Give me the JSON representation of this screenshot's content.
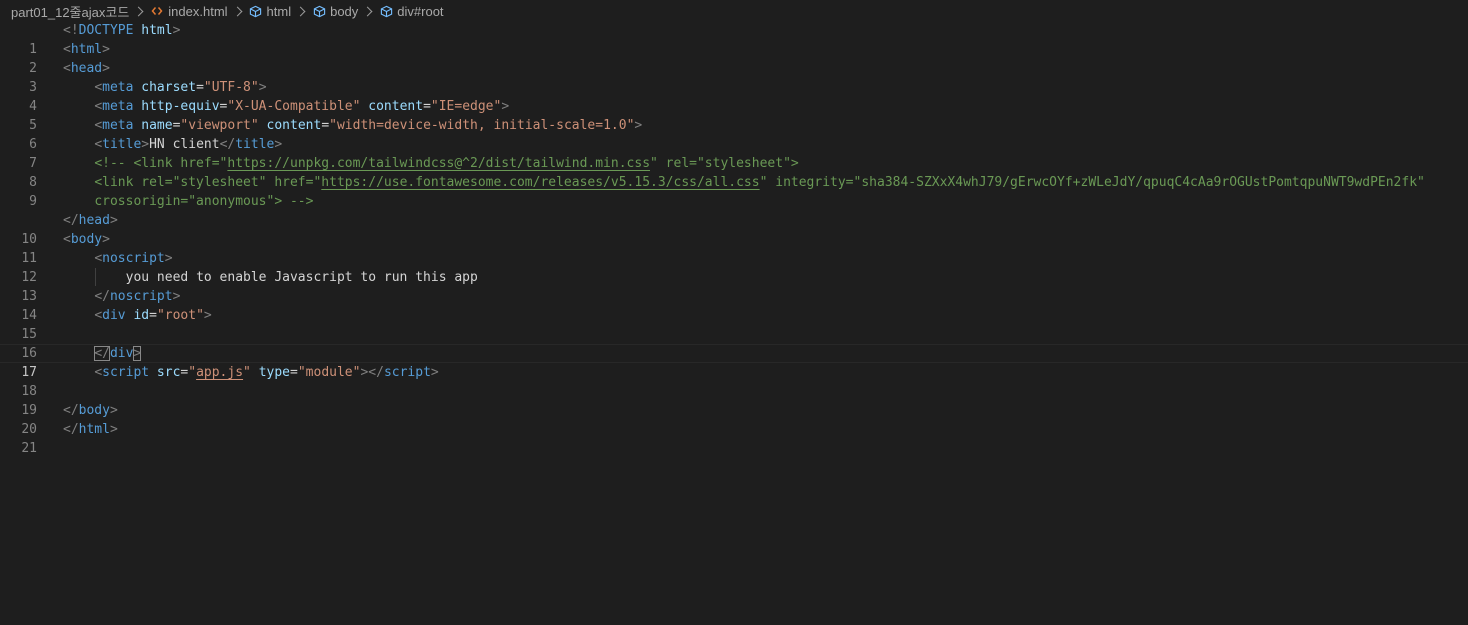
{
  "breadcrumb": {
    "folder": "part01_12줄ajax코드",
    "file": "index.html",
    "symbols": [
      "html",
      "body",
      "div#root"
    ]
  },
  "editor": {
    "current_line": 17,
    "lines": [
      {
        "n": "1"
      },
      {
        "n": "2"
      },
      {
        "n": "3"
      },
      {
        "n": "4"
      },
      {
        "n": "5"
      },
      {
        "n": "6"
      },
      {
        "n": "7"
      },
      {
        "n": "8"
      },
      {
        "n": "9"
      },
      {
        "n": ""
      },
      {
        "n": "10"
      },
      {
        "n": "11"
      },
      {
        "n": "12"
      },
      {
        "n": "13"
      },
      {
        "n": "14"
      },
      {
        "n": "15"
      },
      {
        "n": "16"
      },
      {
        "n": "17"
      },
      {
        "n": "18"
      },
      {
        "n": "19"
      },
      {
        "n": "20"
      },
      {
        "n": "21"
      }
    ],
    "code": {
      "l1": {
        "open": "<!",
        "doctype": "DOCTYPE",
        "sp": " ",
        "html": "html",
        "close": ">"
      },
      "l2": {
        "open": "<",
        "tag": "html",
        "close": ">"
      },
      "l3": {
        "open": "<",
        "tag": "head",
        "close": ">"
      },
      "l4": {
        "indent": "    ",
        "open": "<",
        "tag": "meta",
        "a1": " charset",
        "eq1": "=",
        "v1": "\"UTF-8\"",
        "close": ">"
      },
      "l5": {
        "indent": "    ",
        "open": "<",
        "tag": "meta",
        "a1": " http-equiv",
        "eq1": "=",
        "v1": "\"X-UA-Compatible\"",
        "a2": " content",
        "eq2": "=",
        "v2": "\"IE=edge\"",
        "close": ">"
      },
      "l6": {
        "indent": "    ",
        "open": "<",
        "tag": "meta",
        "a1": " name",
        "eq1": "=",
        "v1": "\"viewport\"",
        "a2": " content",
        "eq2": "=",
        "v2": "\"width=device-width, initial-scale=1.0\"",
        "close": ">"
      },
      "l7": {
        "indent": "    ",
        "open": "<",
        "tag": "title",
        "close": ">",
        "text": "HN client",
        "open2": "</",
        "tag2": "title",
        "close2": ">"
      },
      "l8": {
        "indent": "    ",
        "c1": "<!-- <link href=\"",
        "url": "https://unpkg.com/tailwindcss@^2/dist/tailwind.min.css",
        "c2": "\" rel=\"stylesheet\">"
      },
      "l9": {
        "indent": "    ",
        "c1": "<link rel=\"stylesheet\" href=\"",
        "url": "https://use.fontawesome.com/releases/v5.15.3/css/all.css",
        "c2": "\" integrity=\"sha384-SZXxX4whJ79/gErwcOYf+zWLeJdY/qpuqC4cAa9rOGUstPomtqpuNWT9wdPEn2fk\""
      },
      "l9b": {
        "indent": "    ",
        "c1": "crossorigin=\"anonymous\"> -->"
      },
      "l10": {
        "open": "</",
        "tag": "head",
        "close": ">"
      },
      "l11": {
        "open": "<",
        "tag": "body",
        "close": ">"
      },
      "l12": {
        "indent": "    ",
        "open": "<",
        "tag": "noscript",
        "close": ">"
      },
      "l13": {
        "indent": "        ",
        "text": "you need to enable Javascript to run this app"
      },
      "l14": {
        "indent": "    ",
        "open": "</",
        "tag": "noscript",
        "close": ">"
      },
      "l15": {
        "indent": "    ",
        "open": "<",
        "tag": "div",
        "a1": " id",
        "eq1": "=",
        "v1": "\"root\"",
        "close": ">"
      },
      "l16": {
        "text": ""
      },
      "l17": {
        "indent": "    ",
        "open": "</",
        "tag": "div",
        "close": ">"
      },
      "l18": {
        "indent": "    ",
        "open": "<",
        "tag": "script",
        "a1": " src",
        "eq1": "=",
        "q1": "\"",
        "v1": "app.js",
        "q2": "\"",
        "a2": " type",
        "eq2": "=",
        "v2": "\"module\"",
        "close": ">",
        "open2": "</",
        "tag2": "script",
        "close2": ">"
      },
      "l19": {
        "text": ""
      },
      "l20": {
        "open": "</",
        "tag": "body",
        "close": ">"
      },
      "l21": {
        "open": "</",
        "tag": "html",
        "close": ">"
      }
    }
  },
  "icons": {
    "html_file": "html-file-icon",
    "symbol": "cube-icon",
    "chevron": "chevron-right-icon"
  },
  "colors": {
    "background": "#1e1e1e",
    "tag": "#569cd6",
    "attribute": "#9cdcfe",
    "string": "#ce9178",
    "punctuation": "#808080",
    "comment": "#6a9955",
    "text": "#d4d4d4",
    "line_number": "#858585"
  }
}
